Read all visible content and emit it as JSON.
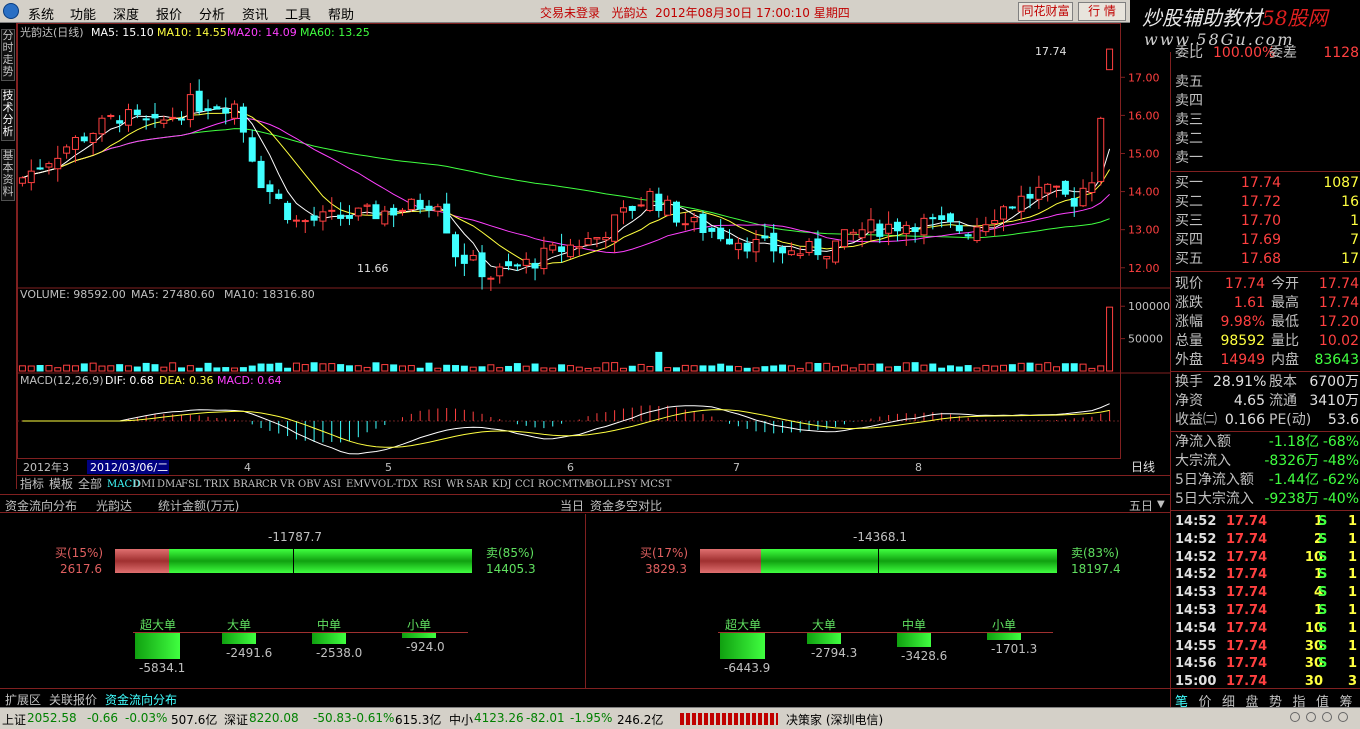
{
  "menu": {
    "items": [
      "系统",
      "功能",
      "深度",
      "报价",
      "分析",
      "资讯",
      "工具",
      "帮助"
    ]
  },
  "title_bar": {
    "login_status": "交易未登录",
    "stock_name": "光韵达",
    "datetime": "2012年08月30日 17:00:10 星期四",
    "btn_finance": "同花财富",
    "btn_quote": "行 情"
  },
  "brand": {
    "line1_a": "炒股辅助教材",
    "line1_b": "58股网",
    "line2": "www.58Gu.com"
  },
  "left_rail": [
    "分时走势",
    "技术分析",
    "基本资料"
  ],
  "kline": {
    "header_name": "光韵达(日线)",
    "ma5": "MA5: 15.10",
    "ma10": "MA10: 14.55",
    "ma20": "MA20: 14.09",
    "ma60": "MA60: 13.25",
    "price_axis": [
      {
        "v": 17.0,
        "t": "17.00"
      },
      {
        "v": 16.0,
        "t": "16.00"
      },
      {
        "v": 15.0,
        "t": "15.00"
      },
      {
        "v": 14.0,
        "t": "14.00"
      },
      {
        "v": 13.0,
        "t": "13.00"
      },
      {
        "v": 12.0,
        "t": "12.00"
      }
    ],
    "high_label": "17.74",
    "low_label": "11.66",
    "colors": {
      "up": "#ff4040",
      "down": "#40ffff",
      "ma5": "#ffffff",
      "ma10": "#ffff40",
      "ma20": "#ff40ff",
      "ma60": "#40ff40"
    }
  },
  "volume": {
    "header": "VOLUME: 98592.00",
    "ma5": "MA5: 27480.60",
    "ma10": "MA10: 18316.80",
    "axis": [
      {
        "v": 100000,
        "t": "100000"
      },
      {
        "v": 50000,
        "t": "50000"
      }
    ]
  },
  "macd": {
    "header": "MACD(12,26,9)",
    "dif": "DIF: 0.68",
    "dea": "DEA: 0.36",
    "macd": "MACD: 0.64"
  },
  "date_axis": {
    "start": "2012年3",
    "selected": "2012/03/06/二",
    "months": [
      "4",
      "5",
      "6",
      "7",
      "8"
    ],
    "period": "日线"
  },
  "indicator_tabs": {
    "left": [
      "指标",
      "模板",
      "全部"
    ],
    "items": [
      "MACD",
      "DMI",
      "DMA",
      "FSL",
      "TRIX",
      "BRAR",
      "CR",
      "VR",
      "OBV",
      "ASI",
      "EMV",
      "VOL-TDX",
      "RSI",
      "WR",
      "SAR",
      "KDJ",
      "CCI",
      "ROC",
      "MTM",
      "BOLL",
      "PSY",
      "MCST"
    ],
    "selected": "MACD"
  },
  "funds": {
    "header_title": "资金流向分布",
    "stock": "光韵达",
    "unit": "统计金额(万元)",
    "mid_label": "当日",
    "compare_label": "资金多空对比",
    "period": "五日",
    "panels": [
      {
        "net": "-11787.7",
        "buy_label": "买(15%)",
        "buy_val": "2617.6",
        "sell_label": "卖(85%)",
        "sell_val": "14405.3",
        "buy_pct": 15,
        "cats": [
          {
            "name": "超大单",
            "val": "-5834.1",
            "mag": 5834.1
          },
          {
            "name": "大单",
            "val": "-2491.6",
            "mag": 2491.6
          },
          {
            "name": "中单",
            "val": "-2538.0",
            "mag": 2538.0
          },
          {
            "name": "小单",
            "val": "-924.0",
            "mag": 924.0
          }
        ]
      },
      {
        "net": "-14368.1",
        "buy_label": "买(17%)",
        "buy_val": "3829.3",
        "sell_label": "卖(83%)",
        "sell_val": "18197.4",
        "buy_pct": 17,
        "cats": [
          {
            "name": "超大单",
            "val": "-6443.9",
            "mag": 6443.9
          },
          {
            "name": "大单",
            "val": "-2794.3",
            "mag": 2794.3
          },
          {
            "name": "中单",
            "val": "-3428.6",
            "mag": 3428.6
          },
          {
            "name": "小单",
            "val": "-1701.3",
            "mag": 1701.3
          }
        ]
      }
    ]
  },
  "bottom_tabs": [
    "扩展区",
    "关联报价",
    "资金流向分布"
  ],
  "status": {
    "sh_label": "上证",
    "sh_val": "2052.58",
    "sh_chg": "-0.66",
    "sh_pct": "-0.03%",
    "sh_amt": "507.6亿",
    "sz_label": "深证",
    "sz_val": "8220.08",
    "sz_chg": "-50.83",
    "sz_pct": "-0.61%",
    "sz_amt": "615.3亿",
    "zx_label": "中小",
    "zx_val": "4123.26",
    "zx_chg": "-82.01",
    "zx_pct": "-1.95%",
    "zx_amt": "246.2亿",
    "broker": "决策家 (深圳电信)"
  },
  "quote": {
    "weibi_label": "委比",
    "weibi_val": "100.00%",
    "weicha_label": "委差",
    "weicha_val": "1128",
    "sell": [
      "卖五",
      "卖四",
      "卖三",
      "卖二",
      "卖一"
    ],
    "buy": [
      {
        "l": "买一",
        "p": "17.74",
        "v": "1087"
      },
      {
        "l": "买二",
        "p": "17.72",
        "v": "16"
      },
      {
        "l": "买三",
        "p": "17.70",
        "v": "1"
      },
      {
        "l": "买四",
        "p": "17.69",
        "v": "7"
      },
      {
        "l": "买五",
        "p": "17.68",
        "v": "17"
      }
    ],
    "stats": [
      {
        "l1": "现价",
        "v1": "17.74",
        "c1": "red",
        "l2": "今开",
        "v2": "17.74",
        "c2": "red"
      },
      {
        "l1": "涨跌",
        "v1": "1.61",
        "c1": "red",
        "l2": "最高",
        "v2": "17.74",
        "c2": "red"
      },
      {
        "l1": "涨幅",
        "v1": "9.98%",
        "c1": "red",
        "l2": "最低",
        "v2": "17.20",
        "c2": "red"
      },
      {
        "l1": "总量",
        "v1": "98592",
        "c1": "yel",
        "l2": "量比",
        "v2": "10.02",
        "c2": "red"
      },
      {
        "l1": "外盘",
        "v1": "14949",
        "c1": "red",
        "l2": "内盘",
        "v2": "83643",
        "c2": "grn"
      }
    ],
    "stats2": [
      {
        "l1": "换手",
        "v1": "28.91%",
        "l2": "股本",
        "v2": "6700万"
      },
      {
        "l1": "净资",
        "v1": "4.65",
        "l2": "流通",
        "v2": "3410万"
      },
      {
        "l1": "收益㈡",
        "v1": "0.166",
        "l2": "PE(动)",
        "v2": "53.6"
      }
    ],
    "flows": [
      {
        "l": "净流入额",
        "v": "-1.18亿",
        "p": "-68%"
      },
      {
        "l": "大宗流入",
        "v": "-8326万",
        "p": "-48%"
      },
      {
        "l": "5日净流入额",
        "v": "-1.44亿",
        "p": "-62%"
      },
      {
        "l": "5日大宗流入",
        "v": "-9238万",
        "p": "-40%"
      }
    ],
    "ticks": [
      {
        "t": "14:52",
        "p": "17.74",
        "v": "1",
        "s": "S",
        "n": "1"
      },
      {
        "t": "14:52",
        "p": "17.74",
        "v": "2",
        "s": "S",
        "n": "1"
      },
      {
        "t": "14:52",
        "p": "17.74",
        "v": "10",
        "s": "S",
        "n": "1"
      },
      {
        "t": "14:52",
        "p": "17.74",
        "v": "1",
        "s": "S",
        "n": "1"
      },
      {
        "t": "14:53",
        "p": "17.74",
        "v": "4",
        "s": "S",
        "n": "1"
      },
      {
        "t": "14:53",
        "p": "17.74",
        "v": "1",
        "s": "S",
        "n": "1"
      },
      {
        "t": "14:54",
        "p": "17.74",
        "v": "10",
        "s": "S",
        "n": "1"
      },
      {
        "t": "14:55",
        "p": "17.74",
        "v": "30",
        "s": "S",
        "n": "1"
      },
      {
        "t": "14:56",
        "p": "17.74",
        "v": "30",
        "s": "S",
        "n": "1"
      },
      {
        "t": "15:00",
        "p": "17.74",
        "v": "30",
        "s": "",
        "n": "3"
      }
    ],
    "tabs": [
      "笔",
      "价",
      "细",
      "盘",
      "势",
      "指",
      "值",
      "筹"
    ]
  }
}
